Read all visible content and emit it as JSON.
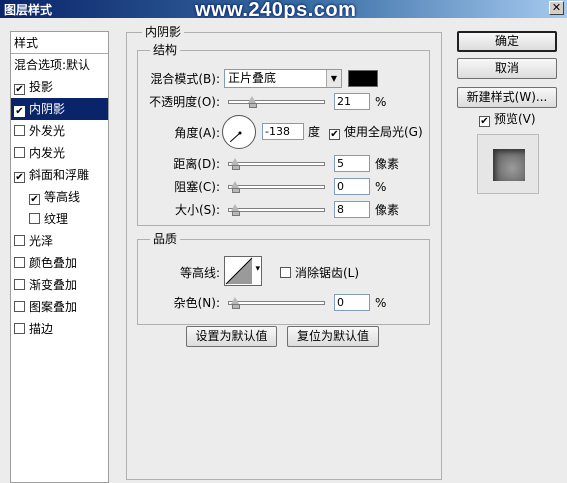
{
  "window": {
    "title": "图层样式",
    "watermark": "www.240ps.com",
    "close_glyph": "✕"
  },
  "left_panel": {
    "header": "样式",
    "items": [
      {
        "label": "混合选项:默认",
        "checkbox": false,
        "checked": false,
        "indent": false,
        "selected": false
      },
      {
        "label": "投影",
        "checkbox": true,
        "checked": true,
        "indent": false,
        "selected": false
      },
      {
        "label": "内阴影",
        "checkbox": true,
        "checked": true,
        "indent": false,
        "selected": true
      },
      {
        "label": "外发光",
        "checkbox": true,
        "checked": false,
        "indent": false,
        "selected": false
      },
      {
        "label": "内发光",
        "checkbox": true,
        "checked": false,
        "indent": false,
        "selected": false
      },
      {
        "label": "斜面和浮雕",
        "checkbox": true,
        "checked": true,
        "indent": false,
        "selected": false
      },
      {
        "label": "等高线",
        "checkbox": true,
        "checked": true,
        "indent": true,
        "selected": false
      },
      {
        "label": "纹理",
        "checkbox": true,
        "checked": false,
        "indent": true,
        "selected": false
      },
      {
        "label": "光泽",
        "checkbox": true,
        "checked": false,
        "indent": false,
        "selected": false
      },
      {
        "label": "颜色叠加",
        "checkbox": true,
        "checked": false,
        "indent": false,
        "selected": false
      },
      {
        "label": "渐变叠加",
        "checkbox": true,
        "checked": false,
        "indent": false,
        "selected": false
      },
      {
        "label": "图案叠加",
        "checkbox": true,
        "checked": false,
        "indent": false,
        "selected": false
      },
      {
        "label": "描边",
        "checkbox": true,
        "checked": false,
        "indent": false,
        "selected": false
      }
    ]
  },
  "inner_shadow": {
    "title": "内阴影",
    "structure": {
      "title": "结构",
      "blend_mode_label": "混合模式(B):",
      "blend_mode_value": "正片叠底",
      "shadow_color": "#000000",
      "opacity_label": "不透明度(O):",
      "opacity_value": "21",
      "opacity_level": 0.21,
      "percent_unit": "%",
      "angle_label": "角度(A):",
      "angle_value": "-138",
      "angle_degrees": -138,
      "degree_unit": "度",
      "global_light_label": "使用全局光(G)",
      "global_light_checked": true,
      "distance_label": "距离(D):",
      "distance_value": "5",
      "distance_level": 0.0,
      "choke_label": "阻塞(C):",
      "choke_value": "0",
      "choke_level": 0.0,
      "size_label": "大小(S):",
      "size_value": "8",
      "size_level": 0.0,
      "pixel_unit": "像素"
    },
    "quality": {
      "title": "品质",
      "contour_label": "等高线:",
      "anti_alias_label": "消除锯齿(L)",
      "anti_alias_checked": false,
      "noise_label": "杂色(N):",
      "noise_value": "0",
      "noise_level": 0.0,
      "percent_unit": "%"
    },
    "make_default_label": "设置为默认值",
    "reset_default_label": "复位为默认值"
  },
  "right": {
    "ok_label": "确定",
    "cancel_label": "取消",
    "new_style_label": "新建样式(W)...",
    "preview_label": "预览(V)",
    "preview_checked": true
  },
  "colors": {
    "selection": "#0a246a",
    "dialog_bg": "#ececec"
  },
  "icons": {
    "dropdown": "▾",
    "check": "✔",
    "blend_dropdown": "▼"
  }
}
